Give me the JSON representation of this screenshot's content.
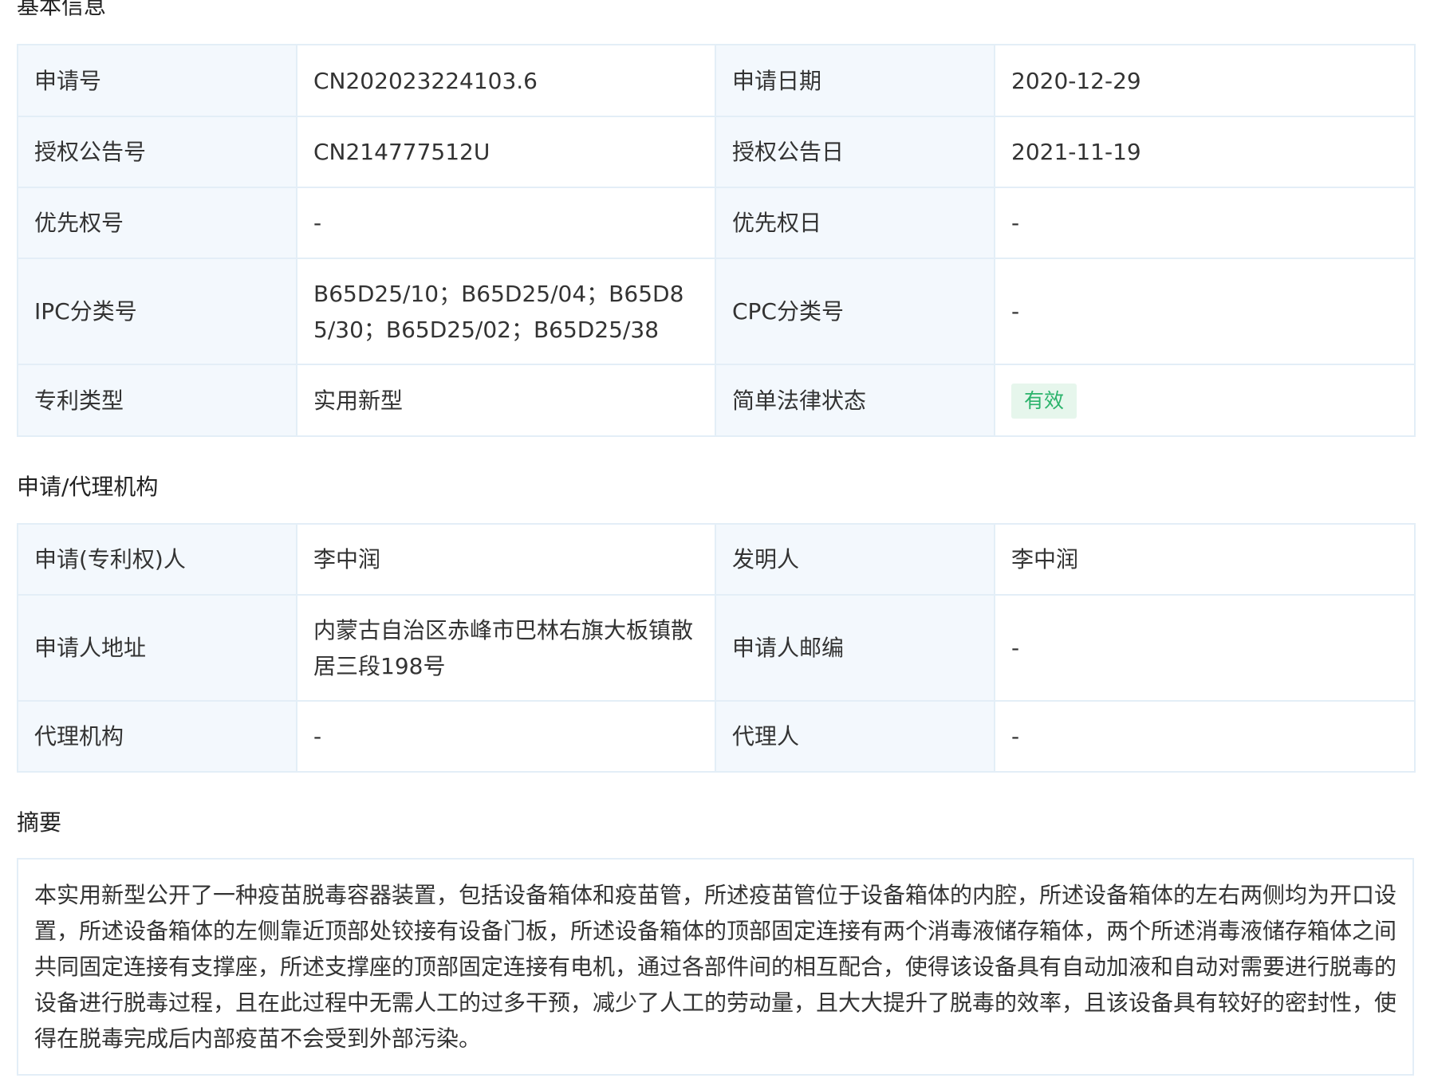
{
  "basic_info": {
    "title": "基本信息",
    "rows": [
      {
        "l1": "申请号",
        "v1": "CN202023224103.6",
        "l2": "申请日期",
        "v2": "2020-12-29"
      },
      {
        "l1": "授权公告号",
        "v1": "CN214777512U",
        "l2": "授权公告日",
        "v2": "2021-11-19"
      },
      {
        "l1": "优先权号",
        "v1": "-",
        "l2": "优先权日",
        "v2": "-"
      },
      {
        "l1": "IPC分类号",
        "v1": "B65D25/10；B65D25/04；B65D85/30；B65D25/02；B65D25/38",
        "l2": "CPC分类号",
        "v2": "-"
      },
      {
        "l1": "专利类型",
        "v1": "实用新型",
        "l2": "简单法律状态",
        "v2": "有效"
      }
    ],
    "status_color": "#2bb36b",
    "status_bg": "#e6f6ec"
  },
  "agency": {
    "title": "申请/代理机构",
    "rows": [
      {
        "l1": "申请(专利权)人",
        "v1": "李中润",
        "l2": "发明人",
        "v2": "李中润"
      },
      {
        "l1": "申请人地址",
        "v1": "内蒙古自治区赤峰市巴林右旗大板镇散居三段198号",
        "l2": "申请人邮编",
        "v2": "-"
      },
      {
        "l1": "代理机构",
        "v1": "-",
        "l2": "代理人",
        "v2": "-"
      }
    ]
  },
  "abstract": {
    "title": "摘要",
    "text": "本实用新型公开了一种疫苗脱毒容器装置，包括设备箱体和疫苗管，所述疫苗管位于设备箱体的内腔，所述设备箱体的左右两侧均为开口设置，所述设备箱体的左侧靠近顶部处铰接有设备门板，所述设备箱体的顶部固定连接有两个消毒液储存箱体，两个所述消毒液储存箱体之间共同固定连接有支撑座，所述支撑座的顶部固定连接有电机，通过各部件间的相互配合，使得该设备具有自动加液和自动对需要进行脱毒的设备进行脱毒过程，且在此过程中无需人工的过多干预，减少了人工的劳动量，且大大提升了脱毒的效率，且该设备具有较好的密封性，使得在脱毒完成后内部疫苗不会受到外部污染。"
  },
  "colors": {
    "label_bg": "#f3f8fd",
    "border": "#e3eef7"
  }
}
